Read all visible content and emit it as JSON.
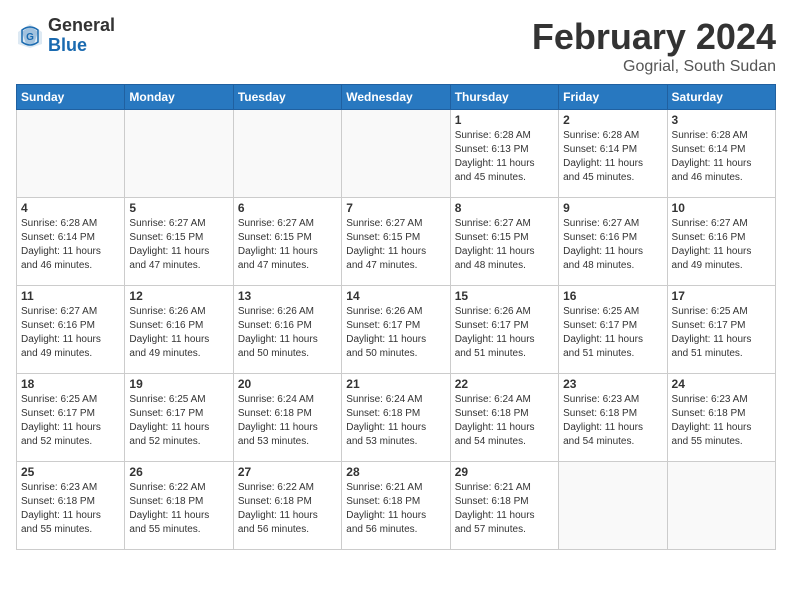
{
  "header": {
    "logo_general": "General",
    "logo_blue": "Blue",
    "month_title": "February 2024",
    "location": "Gogrial, South Sudan"
  },
  "weekdays": [
    "Sunday",
    "Monday",
    "Tuesday",
    "Wednesday",
    "Thursday",
    "Friday",
    "Saturday"
  ],
  "weeks": [
    [
      {
        "day": "",
        "info": ""
      },
      {
        "day": "",
        "info": ""
      },
      {
        "day": "",
        "info": ""
      },
      {
        "day": "",
        "info": ""
      },
      {
        "day": "1",
        "info": "Sunrise: 6:28 AM\nSunset: 6:13 PM\nDaylight: 11 hours\nand 45 minutes."
      },
      {
        "day": "2",
        "info": "Sunrise: 6:28 AM\nSunset: 6:14 PM\nDaylight: 11 hours\nand 45 minutes."
      },
      {
        "day": "3",
        "info": "Sunrise: 6:28 AM\nSunset: 6:14 PM\nDaylight: 11 hours\nand 46 minutes."
      }
    ],
    [
      {
        "day": "4",
        "info": "Sunrise: 6:28 AM\nSunset: 6:14 PM\nDaylight: 11 hours\nand 46 minutes."
      },
      {
        "day": "5",
        "info": "Sunrise: 6:27 AM\nSunset: 6:15 PM\nDaylight: 11 hours\nand 47 minutes."
      },
      {
        "day": "6",
        "info": "Sunrise: 6:27 AM\nSunset: 6:15 PM\nDaylight: 11 hours\nand 47 minutes."
      },
      {
        "day": "7",
        "info": "Sunrise: 6:27 AM\nSunset: 6:15 PM\nDaylight: 11 hours\nand 47 minutes."
      },
      {
        "day": "8",
        "info": "Sunrise: 6:27 AM\nSunset: 6:15 PM\nDaylight: 11 hours\nand 48 minutes."
      },
      {
        "day": "9",
        "info": "Sunrise: 6:27 AM\nSunset: 6:16 PM\nDaylight: 11 hours\nand 48 minutes."
      },
      {
        "day": "10",
        "info": "Sunrise: 6:27 AM\nSunset: 6:16 PM\nDaylight: 11 hours\nand 49 minutes."
      }
    ],
    [
      {
        "day": "11",
        "info": "Sunrise: 6:27 AM\nSunset: 6:16 PM\nDaylight: 11 hours\nand 49 minutes."
      },
      {
        "day": "12",
        "info": "Sunrise: 6:26 AM\nSunset: 6:16 PM\nDaylight: 11 hours\nand 49 minutes."
      },
      {
        "day": "13",
        "info": "Sunrise: 6:26 AM\nSunset: 6:16 PM\nDaylight: 11 hours\nand 50 minutes."
      },
      {
        "day": "14",
        "info": "Sunrise: 6:26 AM\nSunset: 6:17 PM\nDaylight: 11 hours\nand 50 minutes."
      },
      {
        "day": "15",
        "info": "Sunrise: 6:26 AM\nSunset: 6:17 PM\nDaylight: 11 hours\nand 51 minutes."
      },
      {
        "day": "16",
        "info": "Sunrise: 6:25 AM\nSunset: 6:17 PM\nDaylight: 11 hours\nand 51 minutes."
      },
      {
        "day": "17",
        "info": "Sunrise: 6:25 AM\nSunset: 6:17 PM\nDaylight: 11 hours\nand 51 minutes."
      }
    ],
    [
      {
        "day": "18",
        "info": "Sunrise: 6:25 AM\nSunset: 6:17 PM\nDaylight: 11 hours\nand 52 minutes."
      },
      {
        "day": "19",
        "info": "Sunrise: 6:25 AM\nSunset: 6:17 PM\nDaylight: 11 hours\nand 52 minutes."
      },
      {
        "day": "20",
        "info": "Sunrise: 6:24 AM\nSunset: 6:18 PM\nDaylight: 11 hours\nand 53 minutes."
      },
      {
        "day": "21",
        "info": "Sunrise: 6:24 AM\nSunset: 6:18 PM\nDaylight: 11 hours\nand 53 minutes."
      },
      {
        "day": "22",
        "info": "Sunrise: 6:24 AM\nSunset: 6:18 PM\nDaylight: 11 hours\nand 54 minutes."
      },
      {
        "day": "23",
        "info": "Sunrise: 6:23 AM\nSunset: 6:18 PM\nDaylight: 11 hours\nand 54 minutes."
      },
      {
        "day": "24",
        "info": "Sunrise: 6:23 AM\nSunset: 6:18 PM\nDaylight: 11 hours\nand 55 minutes."
      }
    ],
    [
      {
        "day": "25",
        "info": "Sunrise: 6:23 AM\nSunset: 6:18 PM\nDaylight: 11 hours\nand 55 minutes."
      },
      {
        "day": "26",
        "info": "Sunrise: 6:22 AM\nSunset: 6:18 PM\nDaylight: 11 hours\nand 55 minutes."
      },
      {
        "day": "27",
        "info": "Sunrise: 6:22 AM\nSunset: 6:18 PM\nDaylight: 11 hours\nand 56 minutes."
      },
      {
        "day": "28",
        "info": "Sunrise: 6:21 AM\nSunset: 6:18 PM\nDaylight: 11 hours\nand 56 minutes."
      },
      {
        "day": "29",
        "info": "Sunrise: 6:21 AM\nSunset: 6:18 PM\nDaylight: 11 hours\nand 57 minutes."
      },
      {
        "day": "",
        "info": ""
      },
      {
        "day": "",
        "info": ""
      }
    ]
  ]
}
